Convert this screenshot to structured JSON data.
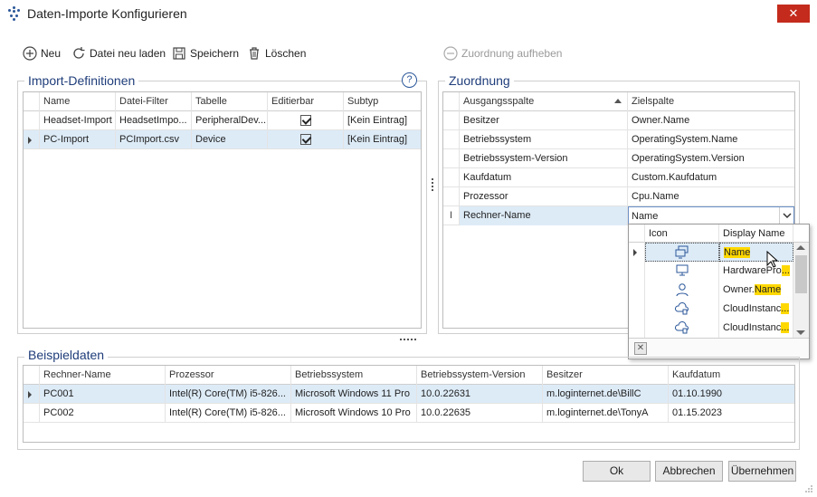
{
  "window": {
    "title": "Daten-Importe Konfigurieren",
    "close_glyph": "✕"
  },
  "toolbar": {
    "new_label": "Neu",
    "reload_label": "Datei neu laden",
    "save_label": "Speichern",
    "delete_label": "Löschen",
    "unassign_label": "Zuordnung aufheben"
  },
  "import_definitions": {
    "title": "Import-Definitionen",
    "help_glyph": "?",
    "columns": [
      "Name",
      "Datei-Filter",
      "Tabelle",
      "Editierbar",
      "Subtyp"
    ],
    "rows": [
      {
        "name": "Headset-Import",
        "filter": "HeadsetImpo...",
        "table": "PeripheralDev...",
        "editable": true,
        "subtype": "[Kein Eintrag]"
      },
      {
        "name": "PC-Import",
        "filter": "PCImport.csv",
        "table": "Device",
        "editable": true,
        "subtype": "[Kein Eintrag]"
      }
    ]
  },
  "mapping": {
    "title": "Zuordnung",
    "columns": [
      "Ausgangsspalte",
      "Zielspalte"
    ],
    "rows": [
      {
        "source": "Besitzer",
        "target": "Owner.Name"
      },
      {
        "source": "Betriebssystem",
        "target": "OperatingSystem.Name"
      },
      {
        "source": "Betriebssystem-Version",
        "target": "OperatingSystem.Version"
      },
      {
        "source": "Kaufdatum",
        "target": "Custom.Kaufdatum"
      },
      {
        "source": "Prozessor",
        "target": "Cpu.Name"
      },
      {
        "source": "Rechner-Name",
        "target": "Name"
      }
    ]
  },
  "dropdown": {
    "columns": [
      "Icon",
      "Display Name"
    ],
    "items": [
      {
        "icon": "computer-network-icon",
        "prefix": "",
        "match": "Name",
        "suffix": ""
      },
      {
        "icon": "monitor-icon",
        "prefix": "HardwarePro",
        "match": "...",
        "suffix": ""
      },
      {
        "icon": "user-icon",
        "prefix": "Owner.",
        "match": "Name",
        "suffix": ""
      },
      {
        "icon": "cloud-device-icon",
        "prefix": "CloudInstanc",
        "match": "...",
        "suffix": ""
      },
      {
        "icon": "cloud-device-icon",
        "prefix": "CloudInstanc",
        "match": "...",
        "suffix": ""
      }
    ],
    "clear_glyph": "✕"
  },
  "sample_data": {
    "title": "Beispieldaten",
    "columns": [
      "Rechner-Name",
      "Prozessor",
      "Betriebssystem",
      "Betriebssystem-Version",
      "Besitzer",
      "Kaufdatum"
    ],
    "rows": [
      [
        "PC001",
        "Intel(R) Core(TM) i5-826...",
        "Microsoft Windows 11 Pro",
        "10.0.22631",
        "m.loginternet.de\\BillC",
        "01.10.1990"
      ],
      [
        "PC002",
        "Intel(R) Core(TM) i5-826...",
        "Microsoft Windows 10 Pro",
        "10.0.22635",
        "m.loginternet.de\\TonyA",
        "01.15.2023"
      ]
    ]
  },
  "buttons": {
    "ok": "Ok",
    "cancel": "Abbrechen",
    "apply": "Übernehmen"
  }
}
